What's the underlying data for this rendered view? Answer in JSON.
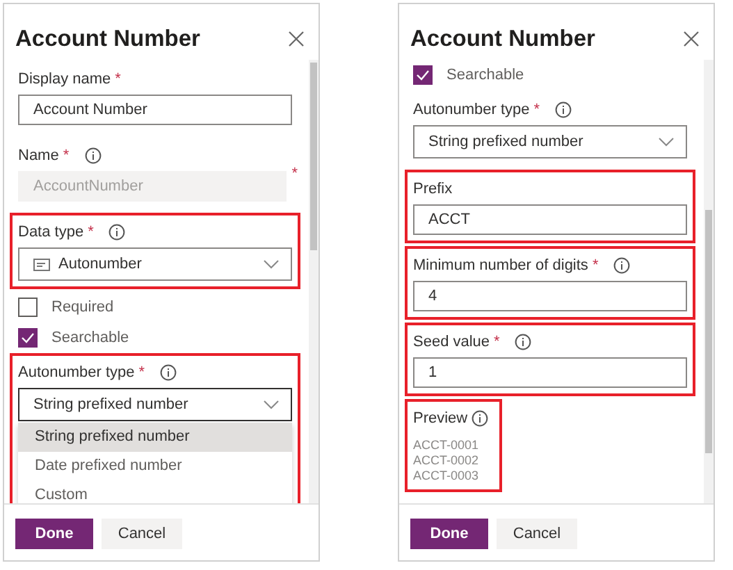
{
  "panels": [
    {
      "title": "Account Number",
      "fields": [
        {
          "kind": "text",
          "label": "Display name",
          "required_mark": "*",
          "value": "Account Number",
          "disabled": false,
          "highlighted": false
        },
        {
          "kind": "text",
          "label": "Name",
          "required_mark": "*",
          "info": true,
          "value": "AccountNumber",
          "disabled": true,
          "trailing": "*",
          "highlighted": false
        },
        {
          "kind": "select",
          "label": "Data type",
          "required_mark": "*",
          "info": true,
          "has_icon": true,
          "value": "Autonumber",
          "highlighted": true
        },
        {
          "kind": "checkbox",
          "label": "Required",
          "checked": false
        },
        {
          "kind": "checkbox",
          "label": "Searchable",
          "checked": true
        },
        {
          "kind": "select",
          "label": "Autonumber type",
          "required_mark": "*",
          "info": true,
          "value": "String prefixed number",
          "highlighted": true,
          "options": [
            {
              "label": "String prefixed number",
              "selected": true
            },
            {
              "label": "Date prefixed number",
              "selected": false
            },
            {
              "label": "Custom",
              "selected": false
            }
          ]
        }
      ],
      "buttons": [
        {
          "label": "Done",
          "kind": "primary"
        },
        {
          "label": "Cancel",
          "kind": "secondary"
        }
      ]
    },
    {
      "title": "Account Number",
      "fields": [
        {
          "kind": "checkbox",
          "label": "Searchable",
          "checked": true
        },
        {
          "kind": "select",
          "label": "Autonumber type",
          "required_mark": "*",
          "info": true,
          "value": "String prefixed number",
          "highlighted": false
        },
        {
          "kind": "text",
          "label": "Prefix",
          "value": "ACCT",
          "disabled": false,
          "highlighted": true
        },
        {
          "kind": "text",
          "label": "Minimum number of digits",
          "required_mark": "*",
          "info": true,
          "value": "4",
          "disabled": false,
          "highlighted": true
        },
        {
          "kind": "text",
          "label": "Seed value",
          "required_mark": "*",
          "info": true,
          "value": "1",
          "disabled": false,
          "highlighted": true
        },
        {
          "kind": "preview",
          "label": "Preview",
          "info": true,
          "lines": [
            "ACCT-0001",
            "ACCT-0002",
            "ACCT-0003"
          ],
          "highlighted": true
        }
      ],
      "buttons": [
        {
          "label": "Done",
          "kind": "primary"
        },
        {
          "label": "Cancel",
          "kind": "secondary"
        }
      ]
    }
  ]
}
